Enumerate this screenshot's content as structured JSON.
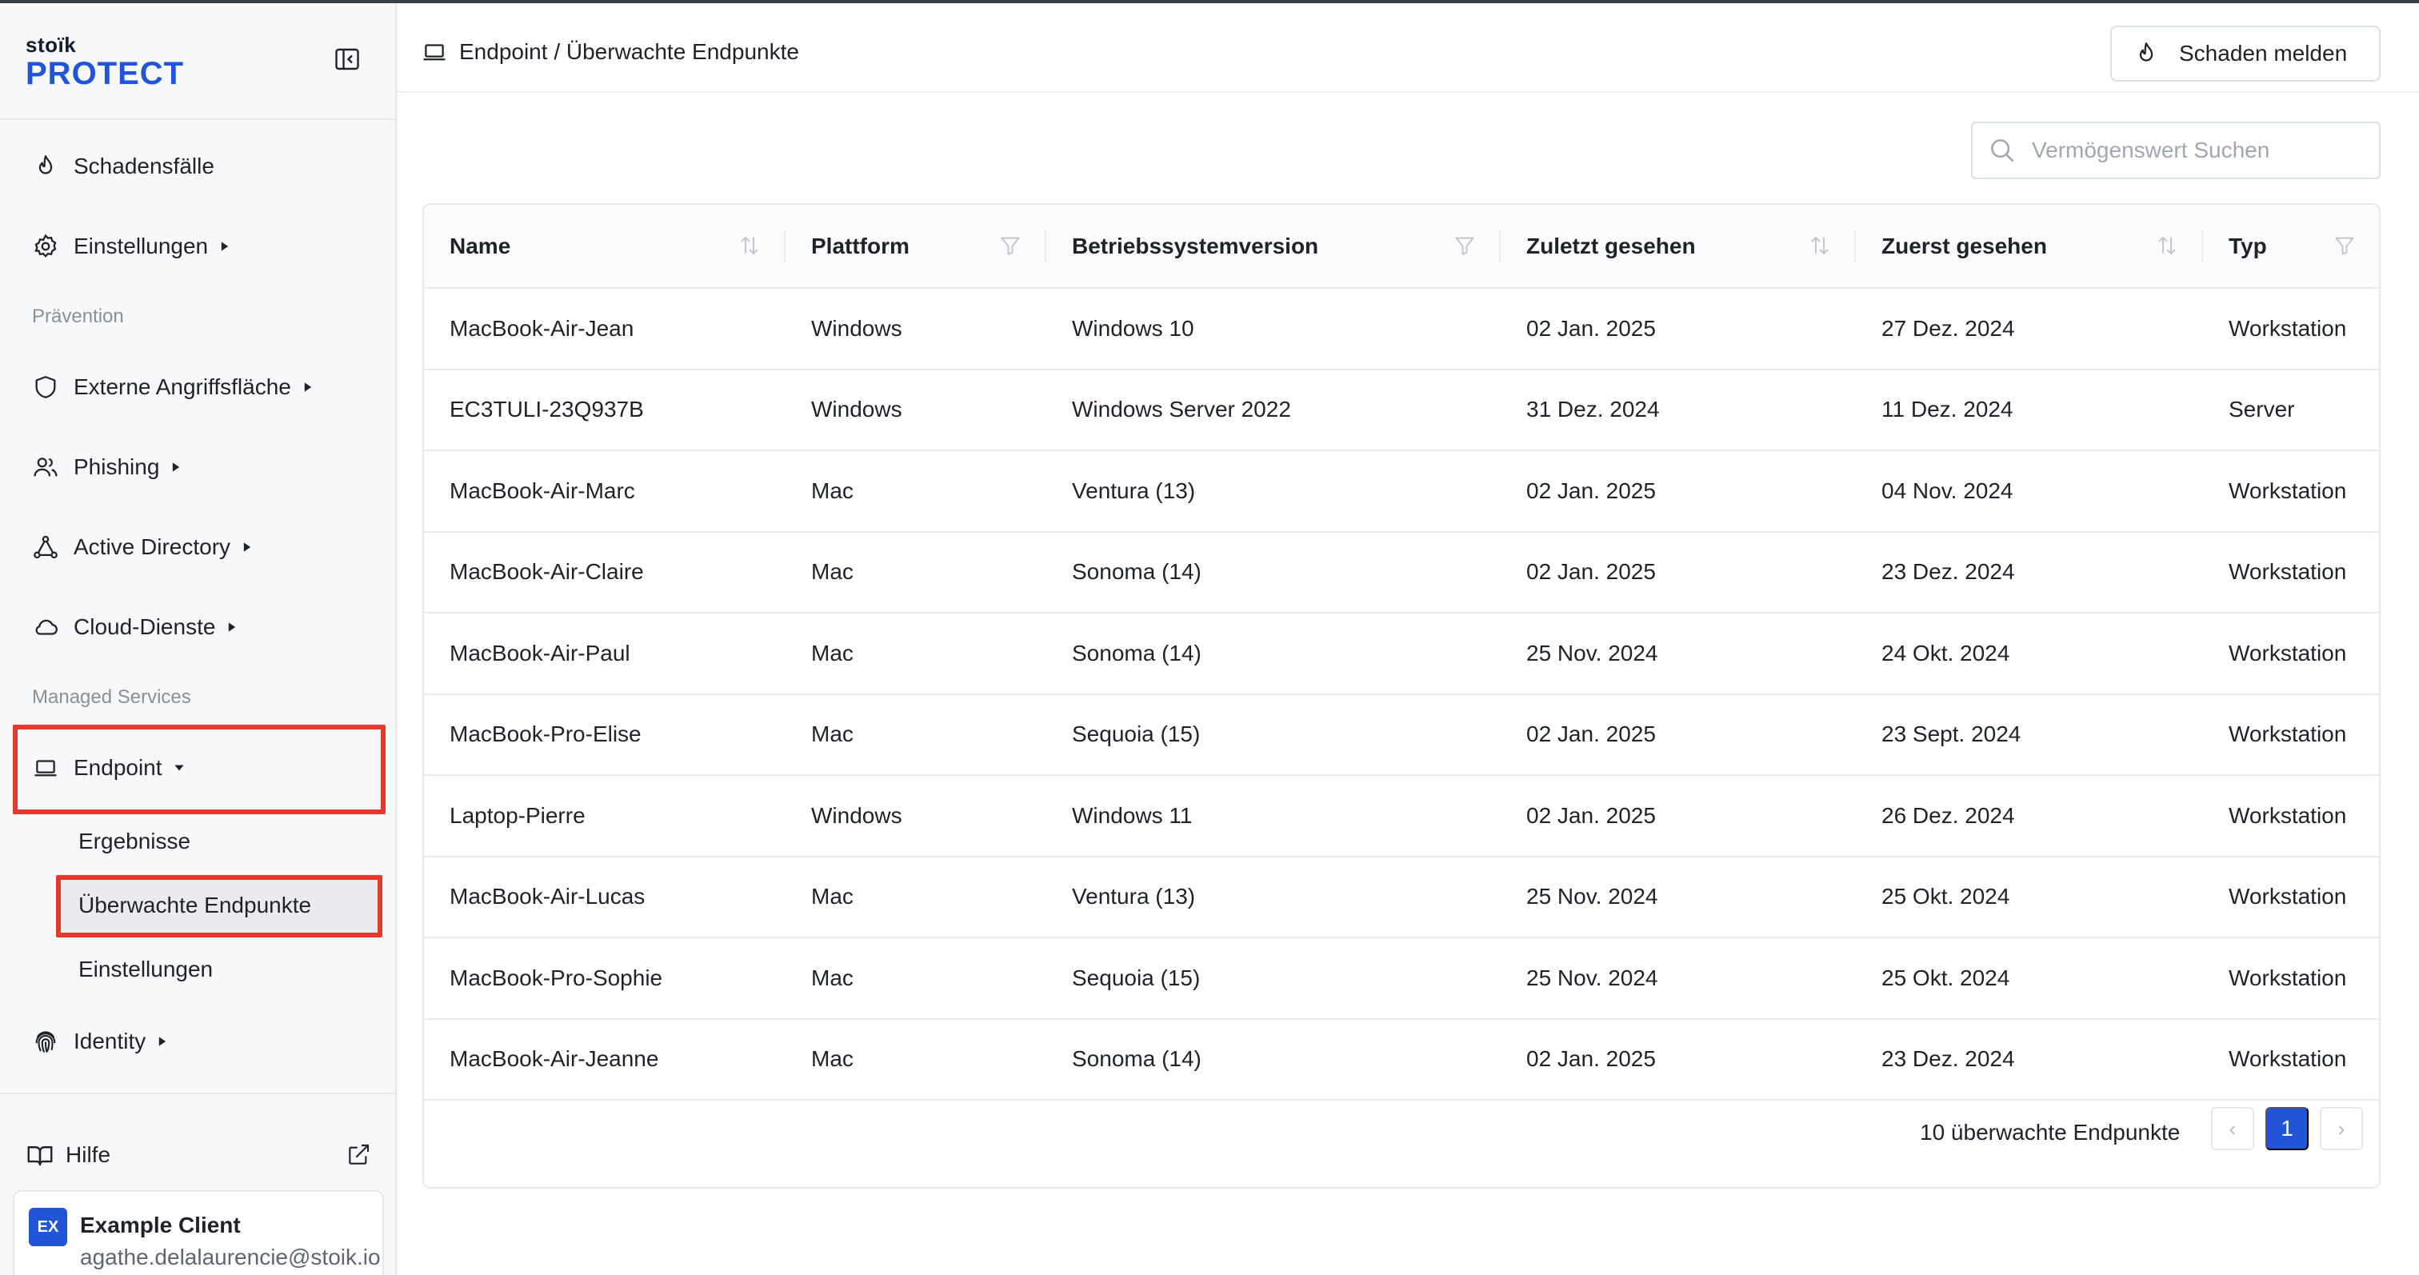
{
  "brand": {
    "small": "stoïk",
    "big": "PROTECT",
    "accent": "#2154d6"
  },
  "sidebar": {
    "top_items": [
      {
        "label": "Schadensfälle",
        "icon": "flame-icon"
      },
      {
        "label": "Einstellungen",
        "icon": "gear-icon"
      }
    ],
    "section_prevention": "Prävention",
    "prevention_items": [
      {
        "label": "Externe Angriffsfläche",
        "icon": "shield-icon"
      },
      {
        "label": "Phishing",
        "icon": "users-icon"
      },
      {
        "label": "Active Directory",
        "icon": "network-icon"
      },
      {
        "label": "Cloud-Dienste",
        "icon": "cloud-icon"
      }
    ],
    "section_managed": "Managed Services",
    "endpoint": {
      "label": "Endpoint",
      "icon": "laptop-icon"
    },
    "endpoint_sub": [
      "Ergebnisse",
      "Überwachte Endpunkte",
      "Einstellungen"
    ],
    "identity": {
      "label": "Identity",
      "icon": "fingerprint-icon"
    },
    "help": "Hilfe",
    "client": {
      "avatar": "EX",
      "name": "Example Client",
      "email": "agathe.delalaurencie@stoik.io"
    }
  },
  "header": {
    "breadcrumb": "Endpoint / Überwachte Endpunkte",
    "report_button": "Schaden melden"
  },
  "search": {
    "placeholder": "Vermögenswert Suchen",
    "value": ""
  },
  "table": {
    "columns": [
      "Name",
      "Plattform",
      "Betriebssystemversion",
      "Zuletzt gesehen",
      "Zuerst gesehen",
      "Typ"
    ],
    "rows": [
      [
        "MacBook-Air-Jean",
        "Windows",
        "Windows 10",
        "02 Jan. 2025",
        "27 Dez. 2024",
        "Workstation"
      ],
      [
        "EC3TULI-23Q937B",
        "Windows",
        "Windows Server 2022",
        "31 Dez. 2024",
        "11 Dez. 2024",
        "Server"
      ],
      [
        "MacBook-Air-Marc",
        "Mac",
        "Ventura (13)",
        "02 Jan. 2025",
        "04 Nov. 2024",
        "Workstation"
      ],
      [
        "MacBook-Air-Claire",
        "Mac",
        "Sonoma (14)",
        "02 Jan. 2025",
        "23 Dez. 2024",
        "Workstation"
      ],
      [
        "MacBook-Air-Paul",
        "Mac",
        "Sonoma (14)",
        "25 Nov. 2024",
        "24 Okt. 2024",
        "Workstation"
      ],
      [
        "MacBook-Pro-Elise",
        "Mac",
        "Sequoia (15)",
        "02 Jan. 2025",
        "23 Sept. 2024",
        "Workstation"
      ],
      [
        "Laptop-Pierre",
        "Windows",
        "Windows 11",
        "02 Jan. 2025",
        "26 Dez. 2024",
        "Workstation"
      ],
      [
        "MacBook-Air-Lucas",
        "Mac",
        "Ventura (13)",
        "25 Nov. 2024",
        "25 Okt. 2024",
        "Workstation"
      ],
      [
        "MacBook-Pro-Sophie",
        "Mac",
        "Sequoia (15)",
        "25 Nov. 2024",
        "25 Okt. 2024",
        "Workstation"
      ],
      [
        "MacBook-Air-Jeanne",
        "Mac",
        "Sonoma (14)",
        "02 Jan. 2025",
        "23 Dez. 2024",
        "Workstation"
      ]
    ]
  },
  "pagination": {
    "count_label": "10 überwachte Endpunkte",
    "current_page": "1",
    "prev": "‹",
    "next": "›"
  },
  "highlight_color": "#e23a2e"
}
